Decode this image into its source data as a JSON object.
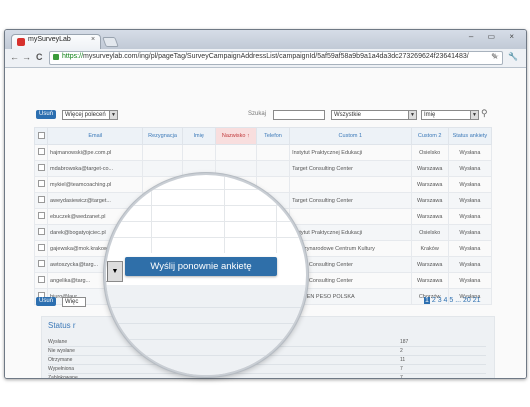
{
  "browser": {
    "tab_title": "mySurveyLab",
    "tab_close": "×",
    "url_scheme": "https://",
    "url_rest": "mysurveylab.com/ing/pl/pageTag/SurveyCampaignAddressList/campaignId/5af59af58a9b9a1a4da3dc273269624f23641483/",
    "window_controls": "– ▭ ×",
    "nav": {
      "back": "←",
      "forward": "→",
      "reload": "C"
    },
    "toolbar_icons": "✎ 🔧"
  },
  "toolbar": {
    "delete_button": "Usuń",
    "more_options_select": "Więcej poleceń",
    "search_label": "Szukaj",
    "filter_all": "Wszystkie",
    "field_select": "Imię"
  },
  "table": {
    "headers": [
      "Email",
      "Rezygnacja",
      "Imię",
      "Nazwisko ↑",
      "Telefon",
      "Custom 1",
      "Custom 2",
      "Status ankiety"
    ],
    "rows": [
      {
        "email": "hajmanowski@pe.com.pl",
        "custom1": "Instytut Praktycznej Edukacji",
        "custom2": "Osielsko",
        "status": "Wysłana"
      },
      {
        "email": "mdabrowska@target-co...",
        "custom1": "Target Consulting Center",
        "custom2": "Warszawa",
        "status": "Wysłana"
      },
      {
        "email": "mykiel@teamcoaching.pl",
        "custom1": "",
        "custom2": "Warszawa",
        "status": "Wysłana"
      },
      {
        "email": "aweydasiewicz@target...",
        "custom1": "Target Consulting Center",
        "custom2": "Warszawa",
        "status": "Wysłana"
      },
      {
        "email": "ebuczek@wedzanet.pl",
        "custom1": "",
        "custom2": "Warszawa",
        "status": "Wysłana"
      },
      {
        "email": "darek@bogatyojciec.pl",
        "custom1": "Instytut Praktycznej Edukacji",
        "custom2": "Osielsko",
        "status": "Wysłana"
      },
      {
        "email": "gajewska@mok.krakow...",
        "custom1": "Międzynarodowe Centrum Kultury",
        "custom2": "Kraków",
        "status": "Wysłana"
      },
      {
        "email": "awtoszycka@targ...",
        "custom1": "Target Consulting Center",
        "custom2": "Warszawa",
        "status": "Wysłana"
      },
      {
        "email": "angelika@targ...",
        "custom1": "Target Consulting Center",
        "custom2": "Warszawa",
        "status": "Wysłana"
      },
      {
        "email": "biuro@laur...",
        "custom1": "LAUREN PESO POLSKA",
        "custom2": "Chorzów",
        "status": "Wysłana"
      }
    ]
  },
  "bottom": {
    "delete_button": "Usuń",
    "select_value": "Więc"
  },
  "pager": {
    "current": "1",
    "others": "2 3 4 5 ... 20 21"
  },
  "status": {
    "title": "Status r",
    "rows": [
      {
        "label": "Wysłane",
        "value": "187"
      },
      {
        "label": "Nie wysłane",
        "value": "2"
      },
      {
        "label": "Otrzymane",
        "value": "11"
      },
      {
        "label": "Wypełniona",
        "value": "7"
      },
      {
        "label": "Zablokowane",
        "value": "7"
      },
      {
        "label": "Wszystkie kontakty",
        "value": "207"
      }
    ]
  },
  "magnifier": {
    "resend_button": "Wyślij ponownie ankietę",
    "select_value": "..",
    "arrow": "▼",
    "status_fragment": "ora"
  }
}
